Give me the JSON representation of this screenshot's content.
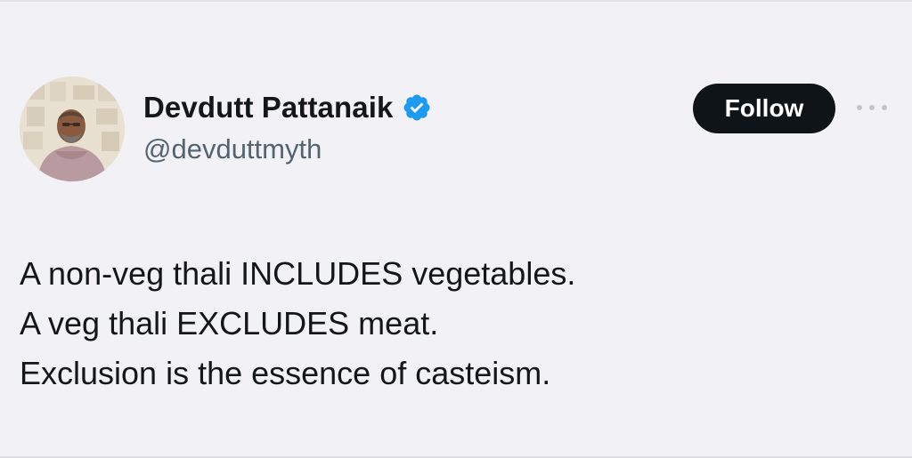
{
  "author": {
    "display_name": "Devdutt Pattanaik",
    "handle": "@devduttmyth",
    "verified": true,
    "verified_icon": "verified-badge-icon",
    "verified_color": "#1d9bf0"
  },
  "actions": {
    "follow_label": "Follow",
    "more_icon": "more-horizontal-icon"
  },
  "tweet": {
    "lines": [
      "A non-veg thali INCLUDES vegetables.",
      "A veg thali EXCLUDES meat.",
      "Exclusion is the essence of casteism."
    ]
  },
  "colors": {
    "background": "#f2f1f6",
    "follow_button_bg": "#0f1419",
    "handle_text": "#536471"
  }
}
